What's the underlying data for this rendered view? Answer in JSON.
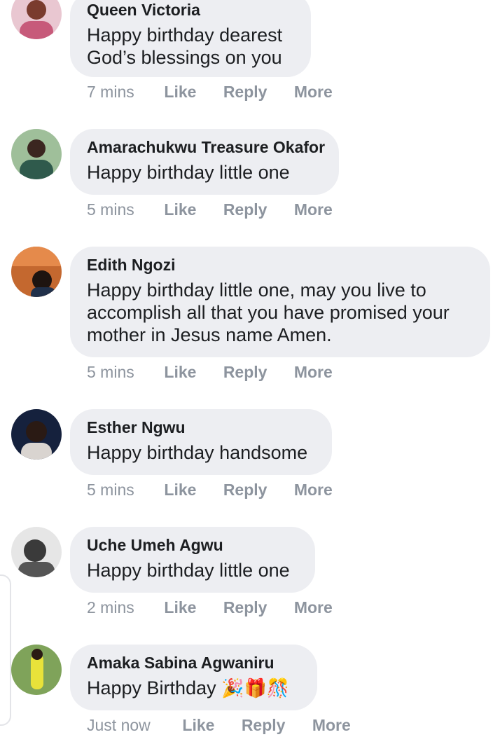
{
  "comments": [
    {
      "name": "Queen Victoria",
      "text": "Happy birthday dearest\nGod’s blessings on you",
      "time": "7 mins",
      "like": "Like",
      "reply": "Reply",
      "more": "More",
      "avatar_color": "#c75a7a"
    },
    {
      "name": "Amarachukwu Treasure Okafor",
      "text": "Happy birthday little one",
      "time": "5 mins",
      "like": "Like",
      "reply": "Reply",
      "more": "More",
      "avatar_color": "#3e6b55"
    },
    {
      "name": "Edith Ngozi",
      "text": "Happy birthday little one, may you live to\naccomplish all that you have promised your\nmother in Jesus name Amen.",
      "time": "5 mins",
      "like": "Like",
      "reply": "Reply",
      "more": "More",
      "avatar_color": "#b4552c"
    },
    {
      "name": "Esther Ngwu",
      "text": "Happy birthday handsome",
      "time": "5 mins",
      "like": "Like",
      "reply": "Reply",
      "more": "More",
      "avatar_color": "#1a2a4a"
    },
    {
      "name": "Uche Umeh Agwu",
      "text": "Happy birthday little one",
      "time": "2 mins",
      "like": "Like",
      "reply": "Reply",
      "more": "More",
      "avatar_color": "#5a5a5a"
    },
    {
      "name": "Amaka Sabina Agwaniru",
      "text": "Happy Birthday ",
      "emoji": "🎉🎁🎊",
      "time": "Just now",
      "like": "Like",
      "reply": "Reply",
      "more": "More",
      "avatar_color": "#6a8f3a"
    }
  ],
  "colors": {
    "bubble": "#edeef2",
    "name_text": "#1c1e21",
    "meta_text": "#8d949e"
  }
}
